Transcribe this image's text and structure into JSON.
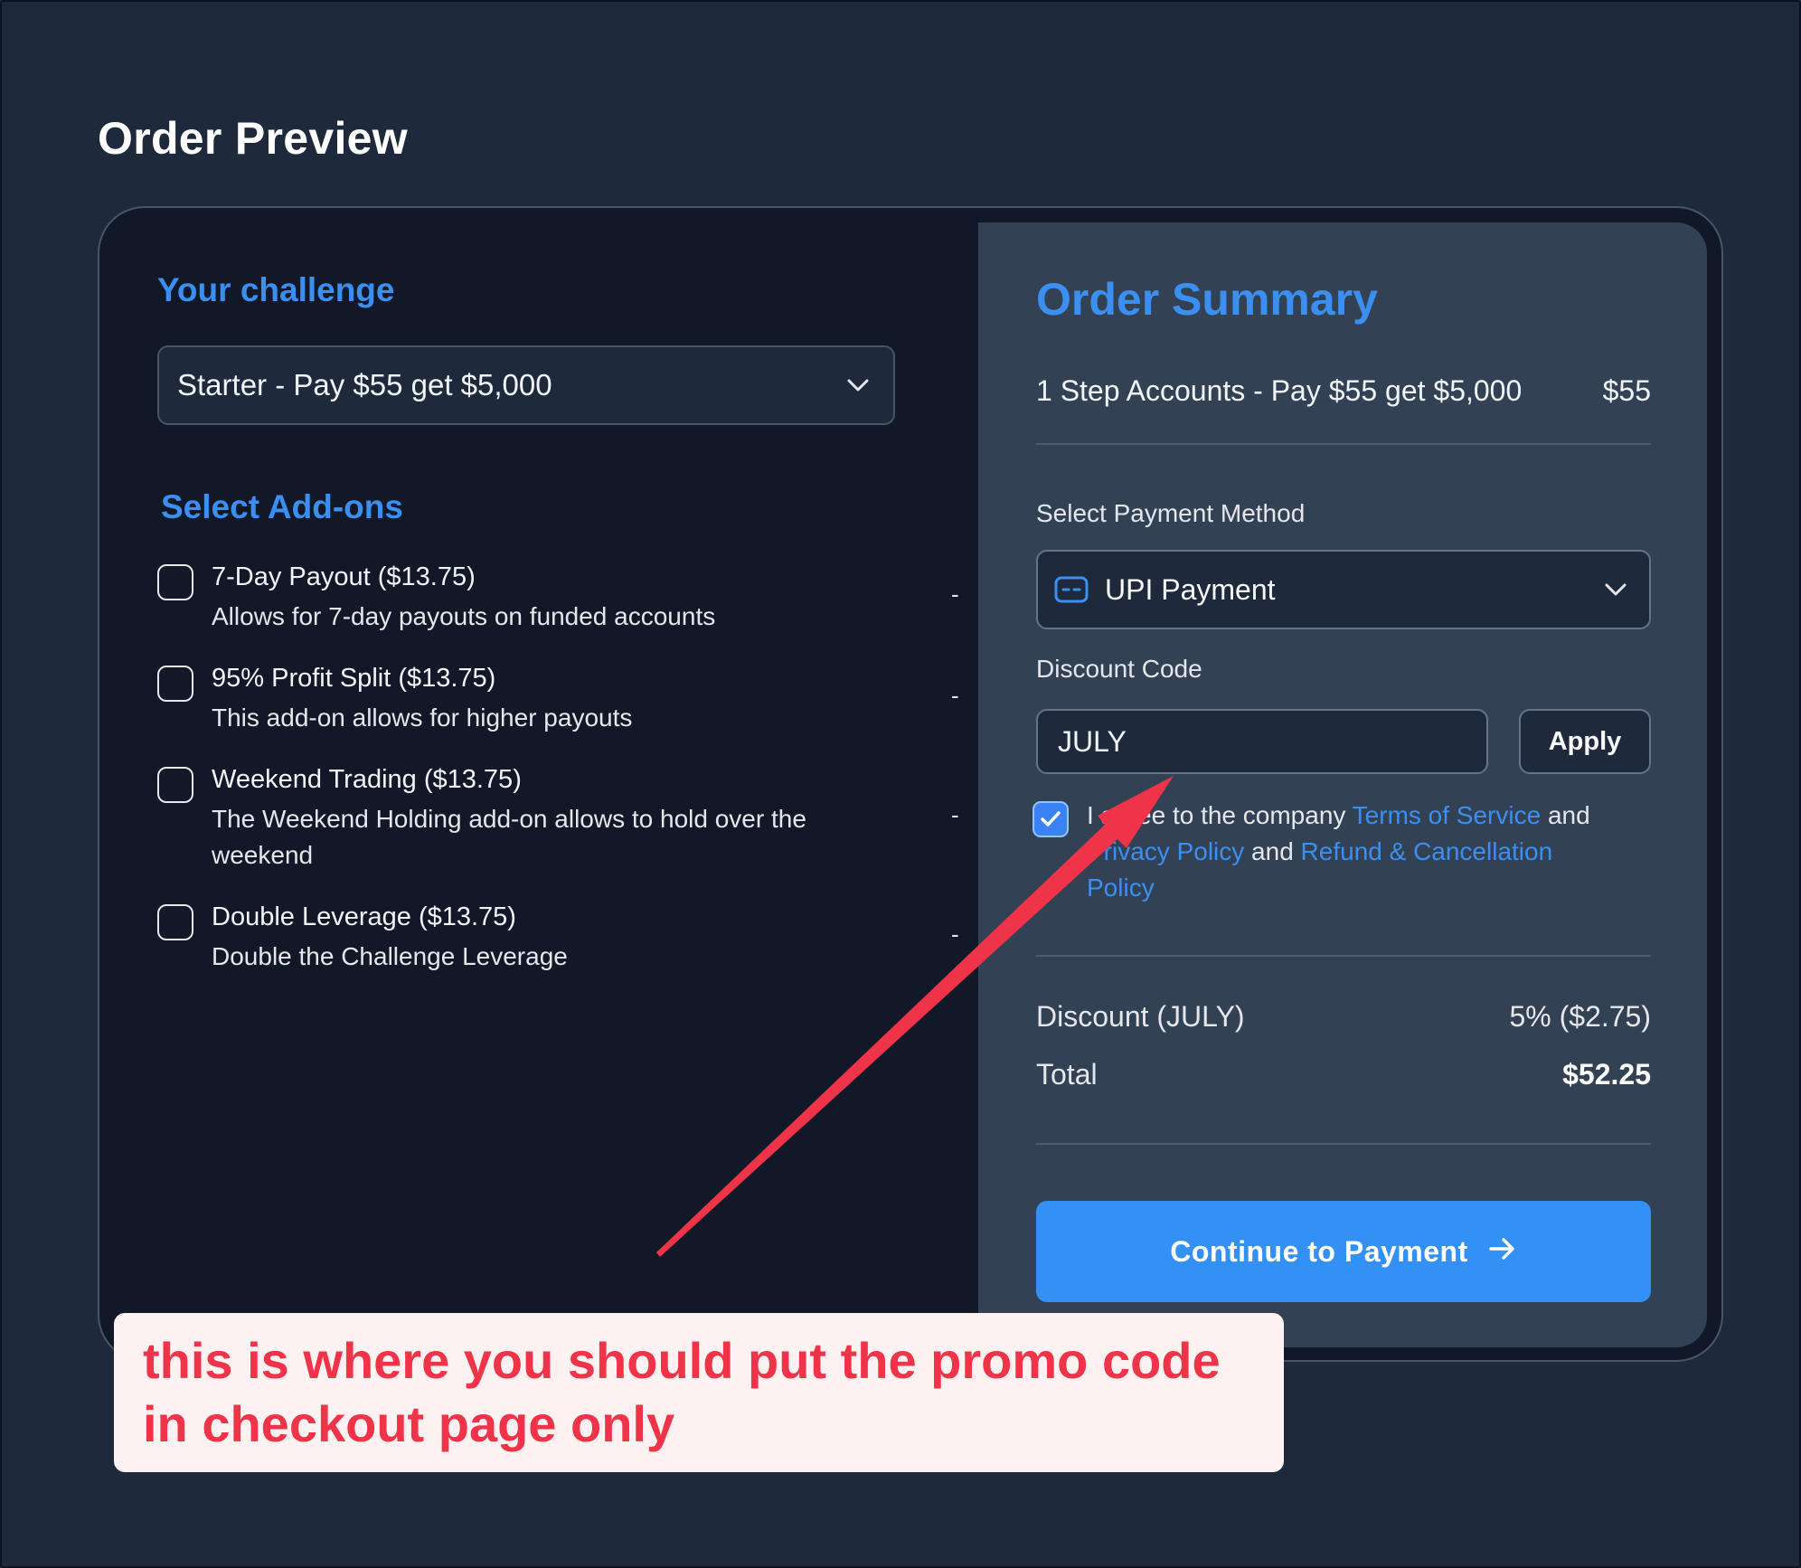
{
  "page": {
    "title": "Order Preview"
  },
  "challenge": {
    "heading": "Your challenge",
    "selected": "Starter - Pay $55 get $5,000"
  },
  "addons": {
    "heading": "Select Add-ons",
    "items": [
      {
        "name": "7-Day Payout ($13.75)",
        "desc": "Allows for 7-day payouts on funded accounts",
        "price": "-"
      },
      {
        "name": "95% Profit Split ($13.75)",
        "desc": "This add-on allows for higher payouts",
        "price": "-"
      },
      {
        "name": "Weekend Trading ($13.75)",
        "desc": "The Weekend Holding add-on allows to hold over the weekend",
        "price": "-"
      },
      {
        "name": "Double Leverage ($13.75)",
        "desc": "Double the Challenge Leverage",
        "price": "-"
      }
    ]
  },
  "summary": {
    "heading": "Order Summary",
    "line_item": {
      "label": "1 Step Accounts - Pay $55 get $5,000",
      "amount": "$55"
    },
    "payment_label": "Select Payment Method",
    "payment_value": "UPI Payment",
    "discount_label": "Discount Code",
    "discount_value": "JULY",
    "apply_label": "Apply",
    "agree": {
      "prefix": "I agree to the company ",
      "terms": "Terms of Service",
      "and1": " and ",
      "privacy": "Privacy Policy",
      "and2": " and ",
      "refund": "Refund & Cancellation Policy"
    },
    "discount_row": {
      "label": "Discount (JULY)",
      "value": "5% ($2.75)"
    },
    "total_row": {
      "label": "Total",
      "value": "$52.25"
    },
    "cta_label": "Continue to Payment"
  },
  "annotation": {
    "text": "this is where you should put the promo code in checkout page only",
    "color": "#ef3348"
  }
}
